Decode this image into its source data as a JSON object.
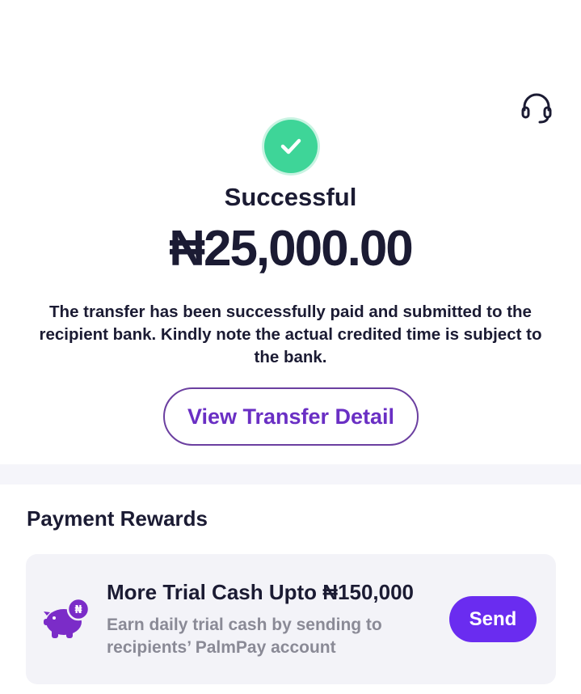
{
  "header": {
    "support_icon": "headset-icon"
  },
  "result": {
    "status_icon": "check-circle-icon",
    "status": "Successful",
    "amount": "₦25,000.00",
    "message": "The transfer has been successfully paid and submitted to the recipient bank. Kindly note the actual credited time is subject to the bank.",
    "detail_button": "View Transfer Detail"
  },
  "rewards": {
    "section_title": "Payment Rewards",
    "card": {
      "icon": "piggy-bank-icon",
      "title": "More Trial Cash Upto ₦150,000",
      "description": "Earn daily trial cash by sending to recipients’ PalmPay account",
      "button": "Send"
    }
  },
  "colors": {
    "success": "#3ed598",
    "accent": "#6a2cf0",
    "outline": "#6b3fa0",
    "text": "#1b1b33",
    "muted": "#8a8a96"
  }
}
